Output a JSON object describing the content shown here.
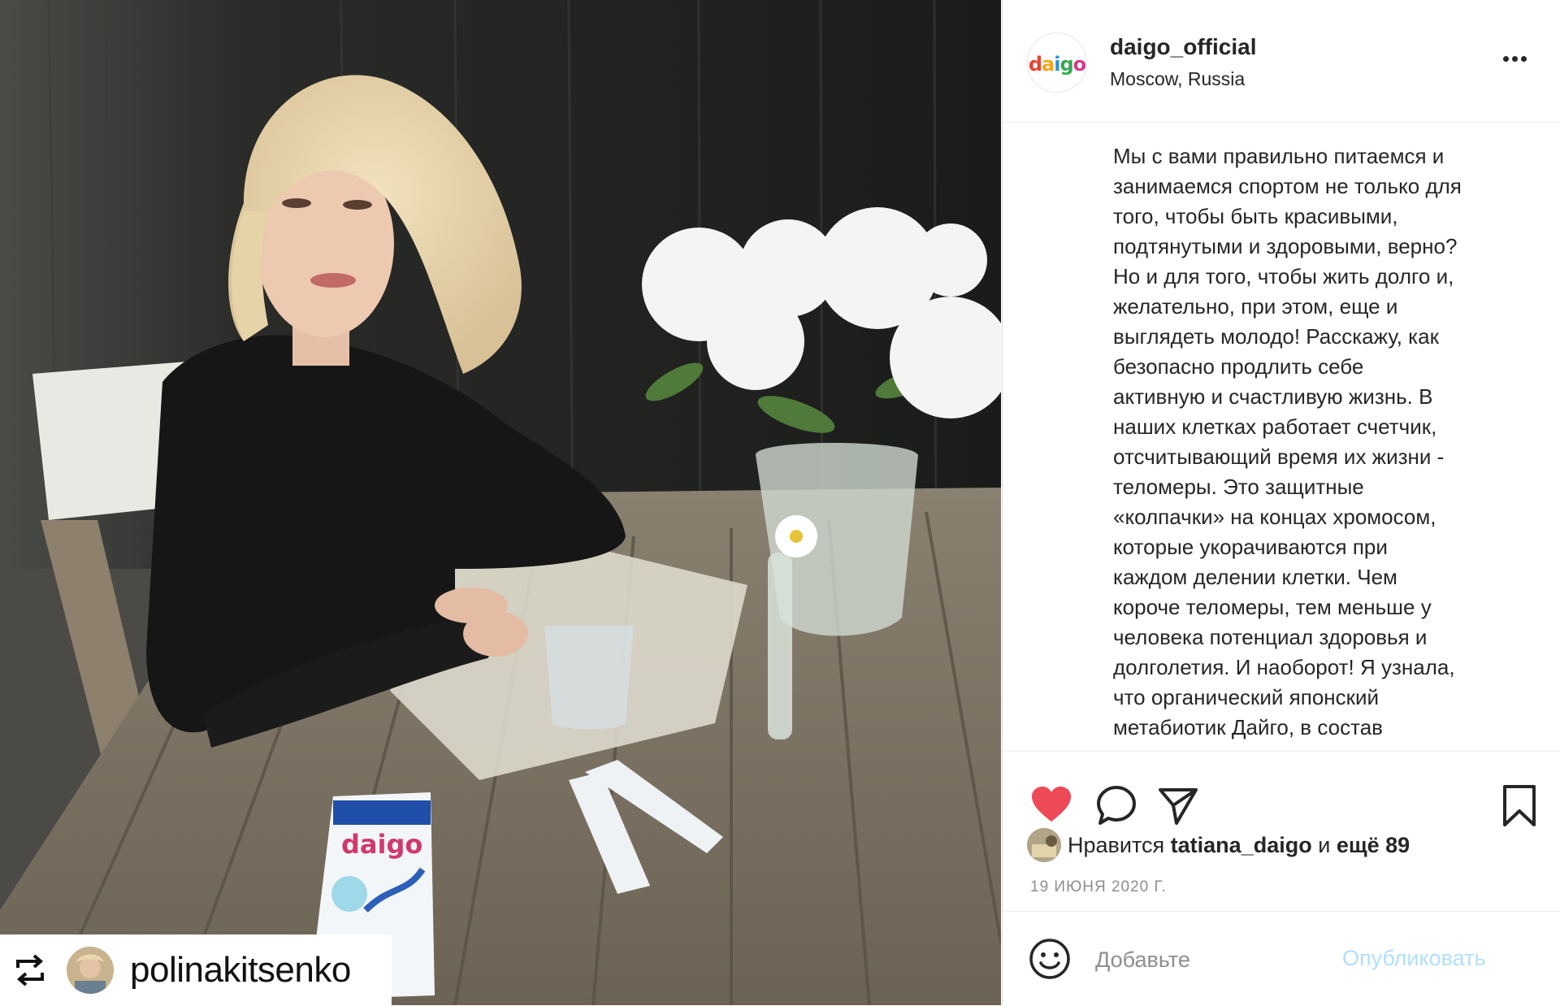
{
  "post": {
    "account": "daigo_official",
    "location": "Moscow, Russia",
    "brand_logo_text": "daigo",
    "caption": "Мы с вами правильно питаемся и\nзанимаемся спортом не только для\nтого, чтобы быть красивыми,\nподтянутыми и здоровыми, верно?\nНо и для того, чтобы жить долго и,\nжелательно, при этом, еще и\nвыглядеть молодо! Расскажу, как\nбезопасно продлить себе\nактивную и счастливую жизнь. В\nнаших клетках работает счетчик,\nотсчитывающий время их жизни -\nтеломеры. Это защитные\n«колпачки» на концах хромосом,\nкоторые укорачиваются при\nкаждом делении клетки. Чем\nкороче теломеры, тем меньше у\nчеловека потенциал здоровья и\nдолголетия. И наоборот! Я узнала,\nчто органический японский\nметабиотик Дайго, в состав",
    "likes": {
      "prefix": "Нравится",
      "user": "tatiana_daigo",
      "connector": "и",
      "rest": "ещё 89"
    },
    "date": "19 ИЮНЯ 2020 Г.",
    "comment_placeholder": "Добавьте",
    "publish_label": "Опубликовать"
  },
  "repost": {
    "username": "polinakitsenko"
  },
  "product": {
    "box_logo": "daigo"
  },
  "icons": {
    "like": "heart-filled-icon",
    "comment": "speech-bubble-icon",
    "share": "paper-plane-icon",
    "save": "bookmark-icon",
    "more": "ellipsis-icon",
    "emoji": "smiley-icon",
    "repost": "repost-arrows-icon"
  },
  "colors": {
    "like_red": "#ed4956",
    "text": "#262626",
    "muted": "#8e8e8e",
    "publish_disabled": "#b2dffc",
    "divider": "#efefef"
  }
}
